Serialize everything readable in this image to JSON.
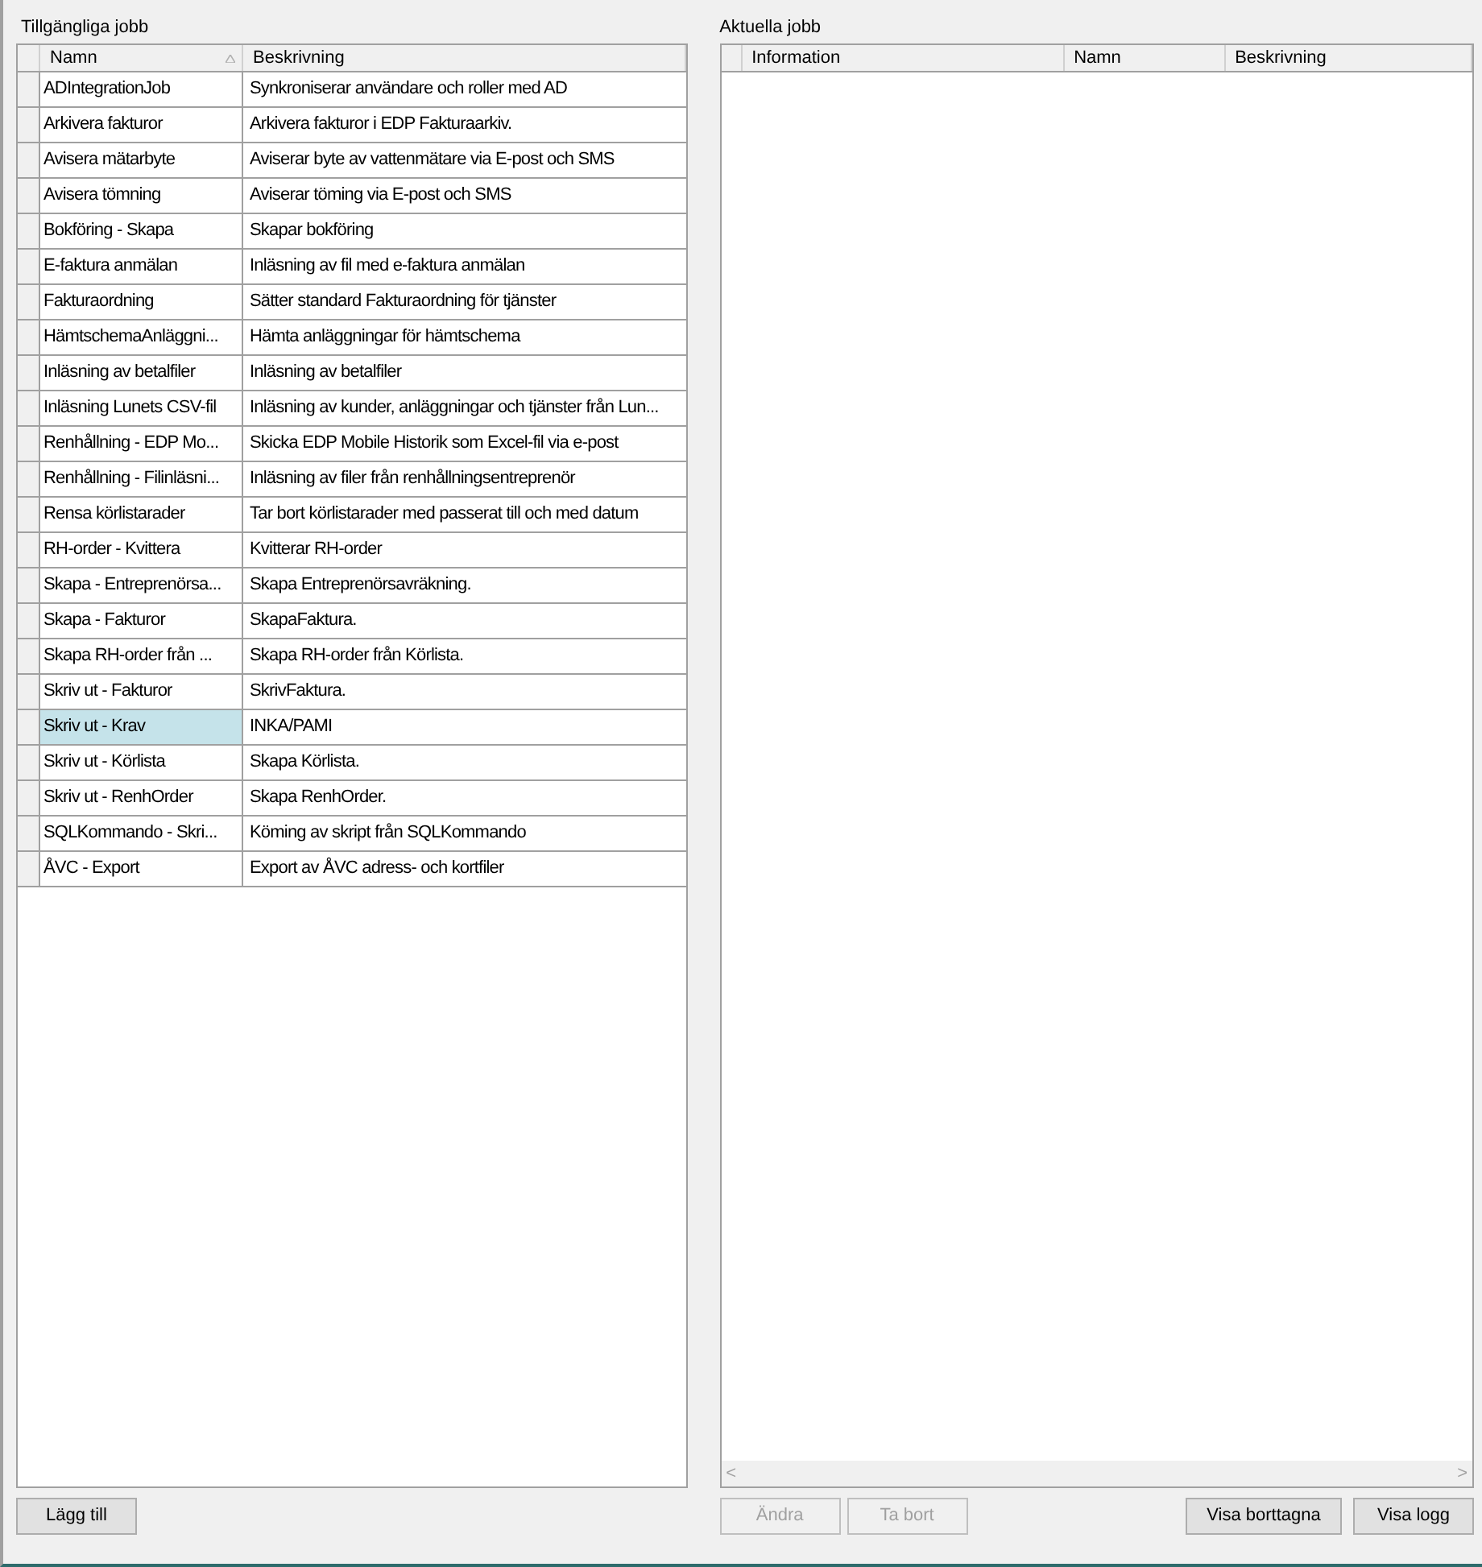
{
  "available_jobs": {
    "title": "Tillgängliga jobb",
    "columns": [
      {
        "label": "Namn",
        "sorted": true
      },
      {
        "label": "Beskrivning",
        "sorted": false
      }
    ],
    "rows": [
      {
        "name": "ADIntegrationJob",
        "description": "Synkroniserar användare och roller med AD",
        "selected": false
      },
      {
        "name": "Arkivera fakturor",
        "description": "Arkivera fakturor i EDP Fakturaarkiv.",
        "selected": false
      },
      {
        "name": "Avisera mätarbyte",
        "description": "Aviserar byte av vattenmätare via E-post och SMS",
        "selected": false
      },
      {
        "name": "Avisera tömning",
        "description": "Aviserar töming via E-post och SMS",
        "selected": false
      },
      {
        "name": "Bokföring - Skapa",
        "description": "Skapar bokföring",
        "selected": false
      },
      {
        "name": "E-faktura anmälan",
        "description": "Inläsning av fil med e-faktura anmälan",
        "selected": false
      },
      {
        "name": "Fakturaordning",
        "description": "Sätter standard Fakturaordning för tjänster",
        "selected": false
      },
      {
        "name": "HämtschemaAnläggni...",
        "description": "Hämta anläggningar för hämtschema",
        "selected": false
      },
      {
        "name": "Inläsning av betalfiler",
        "description": "Inläsning av betalfiler",
        "selected": false
      },
      {
        "name": "Inläsning Lunets CSV-fil",
        "description": "Inläsning av kunder, anläggningar och tjänster från Lun...",
        "selected": false
      },
      {
        "name": "Renhållning - EDP Mo...",
        "description": "Skicka EDP Mobile Historik som Excel-fil via e-post",
        "selected": false
      },
      {
        "name": "Renhållning - Filinläsni...",
        "description": "Inläsning av filer från renhållningsentreprenör",
        "selected": false
      },
      {
        "name": "Rensa körlistarader",
        "description": "Tar bort körlistarader med passerat till och med datum",
        "selected": false
      },
      {
        "name": "RH-order - Kvittera",
        "description": "Kvitterar RH-order",
        "selected": false
      },
      {
        "name": "Skapa - Entreprenörsa...",
        "description": "Skapa Entreprenörsavräkning.",
        "selected": false
      },
      {
        "name": "Skapa - Fakturor",
        "description": "SkapaFaktura.",
        "selected": false
      },
      {
        "name": "Skapa RH-order från ...",
        "description": "Skapa RH-order från Körlista.",
        "selected": false
      },
      {
        "name": "Skriv ut - Fakturor",
        "description": "SkrivFaktura.",
        "selected": false
      },
      {
        "name": "Skriv ut - Krav",
        "description": "INKA/PAMI",
        "selected": true
      },
      {
        "name": "Skriv ut - Körlista",
        "description": "Skapa Körlista.",
        "selected": false
      },
      {
        "name": "Skriv ut - RenhOrder",
        "description": "Skapa RenhOrder.",
        "selected": false
      },
      {
        "name": "SQLKommando - Skri...",
        "description": "Köming av skript från SQLKommando",
        "selected": false
      },
      {
        "name": "ÅVC - Export",
        "description": "Export av ÅVC adress- och kortfiler",
        "selected": false
      }
    ],
    "buttons": [
      {
        "label": "Lägg till",
        "disabled": false
      }
    ]
  },
  "current_jobs": {
    "title": "Aktuella jobb",
    "columns": [
      {
        "label": "Information"
      },
      {
        "label": "Namn"
      },
      {
        "label": "Beskrivning"
      }
    ],
    "scroll_left": "<",
    "scroll_right": ">",
    "buttons_left": [
      {
        "label": "Ändra",
        "disabled": true
      },
      {
        "label": "Ta bort",
        "disabled": true
      }
    ],
    "buttons_right": [
      {
        "label": "Visa borttagna",
        "disabled": false
      },
      {
        "label": "Visa logg",
        "disabled": false
      }
    ]
  }
}
